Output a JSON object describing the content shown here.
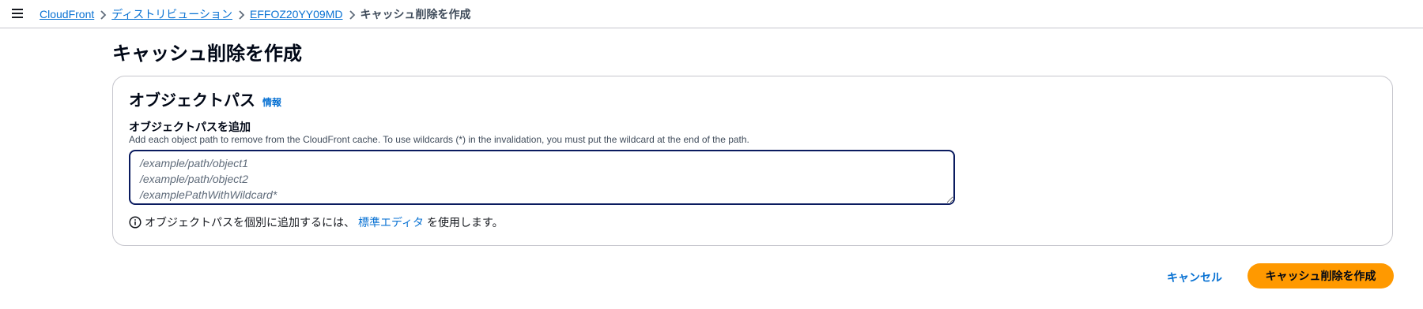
{
  "header": {
    "menu_icon": "hamburger-menu-icon",
    "breadcrumbs": [
      {
        "label": "CloudFront",
        "link": true
      },
      {
        "label": "ディストリビューション",
        "link": true
      },
      {
        "label": "EFFOZ20YY09MD",
        "link": true
      },
      {
        "label": "キャッシュ削除を作成",
        "link": false
      }
    ]
  },
  "page": {
    "title": "キャッシュ削除を作成"
  },
  "object_paths": {
    "title": "オブジェクトパス",
    "info_label": "情報",
    "field_label": "オブジェクトパスを追加",
    "field_description": "Add each object path to remove from the CloudFront cache. To use wildcards (*) in the invalidation, you must put the wildcard at the end of the path.",
    "textarea_value": "",
    "textarea_placeholder": "/example/path/object1\n/example/path/object2\n/examplePathWithWildcard*",
    "hint_prefix": "オブジェクトパスを個別に追加するには、",
    "hint_link": "標準エディタ",
    "hint_suffix": "を使用します。"
  },
  "actions": {
    "cancel_label": "キャンセル",
    "create_label": "キャッシュ削除を作成"
  },
  "colors": {
    "link": "#0972d3",
    "primary_button": "#ff9900",
    "focus_border": "#0a1b5f"
  }
}
